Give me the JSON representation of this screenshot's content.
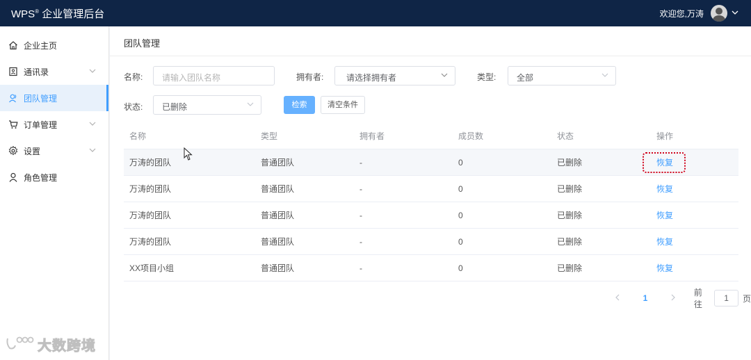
{
  "header": {
    "brand": "WPS",
    "brand_suffix": "企业管理后台",
    "greeting": "欢迎您,万涛"
  },
  "sidebar": {
    "items": [
      {
        "label": "企业主页",
        "icon": "home-icon"
      },
      {
        "label": "通讯录",
        "icon": "contacts-icon",
        "has_arrow": true
      },
      {
        "label": "团队管理",
        "icon": "team-icon",
        "active": true
      },
      {
        "label": "订单管理",
        "icon": "cart-icon",
        "has_arrow": true
      },
      {
        "label": "设置",
        "icon": "gear-icon",
        "has_arrow": true
      },
      {
        "label": "角色管理",
        "icon": "user-icon"
      }
    ],
    "watermark": "大数跨境"
  },
  "main": {
    "page_title": "团队管理",
    "filters": {
      "name_label": "名称:",
      "name_placeholder": "请输入团队名称",
      "owner_label": "拥有者:",
      "owner_placeholder": "请选择拥有者",
      "type_label": "类型:",
      "type_value": "全部",
      "status_label": "状态:",
      "status_value": "已删除",
      "search_button": "检索",
      "clear_button": "清空条件"
    },
    "table": {
      "columns": [
        "名称",
        "类型",
        "拥有者",
        "成员数",
        "状态",
        "操作"
      ],
      "rows": [
        {
          "name": "万涛的团队",
          "type": "普通团队",
          "owner": "-",
          "members": "0",
          "status": "已删除",
          "action": "恢复"
        },
        {
          "name": "万涛的团队",
          "type": "普通团队",
          "owner": "-",
          "members": "0",
          "status": "已删除",
          "action": "恢复"
        },
        {
          "name": "万涛的团队",
          "type": "普通团队",
          "owner": "-",
          "members": "0",
          "status": "已删除",
          "action": "恢复"
        },
        {
          "name": "万涛的团队",
          "type": "普通团队",
          "owner": "-",
          "members": "0",
          "status": "已删除",
          "action": "恢复"
        },
        {
          "name": "XX项目小组",
          "type": "普通团队",
          "owner": "-",
          "members": "0",
          "status": "已删除",
          "action": "恢复"
        }
      ]
    },
    "pagination": {
      "current_page": "1",
      "goto_label": "前往",
      "goto_value": "1",
      "page_suffix": "页"
    }
  },
  "colors": {
    "topbar": "#0f2546",
    "accent": "#409eff",
    "highlight": "#d0021b"
  }
}
